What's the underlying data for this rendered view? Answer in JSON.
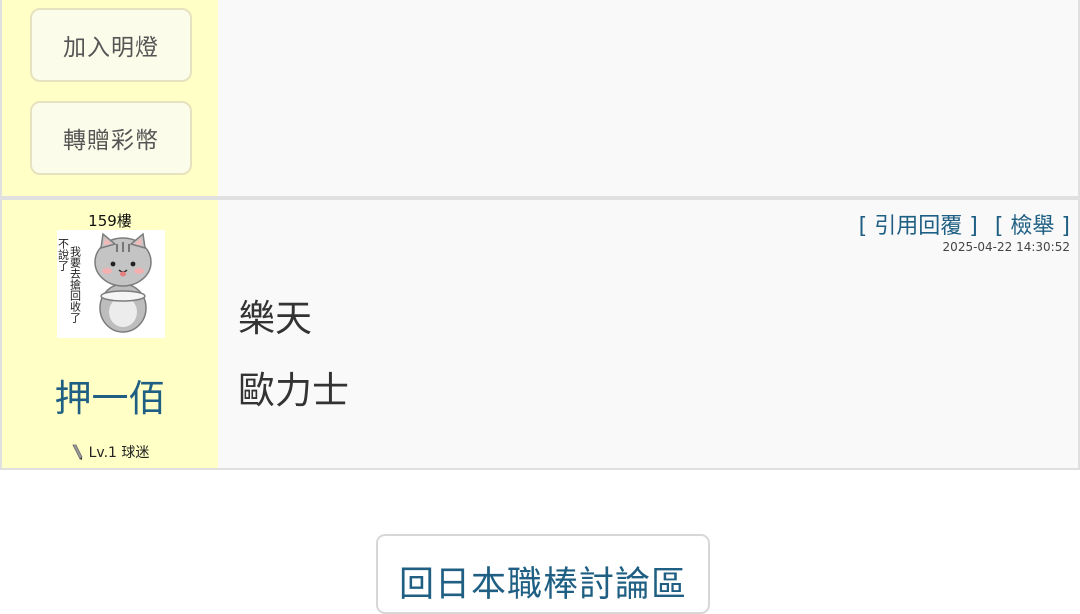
{
  "previous_post": {
    "buttons": [
      "加入明燈",
      "轉贈彩幣"
    ]
  },
  "post": {
    "floor": "159樓",
    "username": "押一佰",
    "level": "Lv.1 球迷",
    "actions": {
      "quote_reply": "引用回覆",
      "report": "檢舉"
    },
    "timestamp": "2025-04-22 14:30:52",
    "content_lines": [
      "樂天",
      "歐力士"
    ],
    "avatar": {
      "caption_right": "我要去搶回收了",
      "caption_left": "不說了"
    }
  },
  "footer": {
    "back_button": "回日本職棒討論區"
  }
}
